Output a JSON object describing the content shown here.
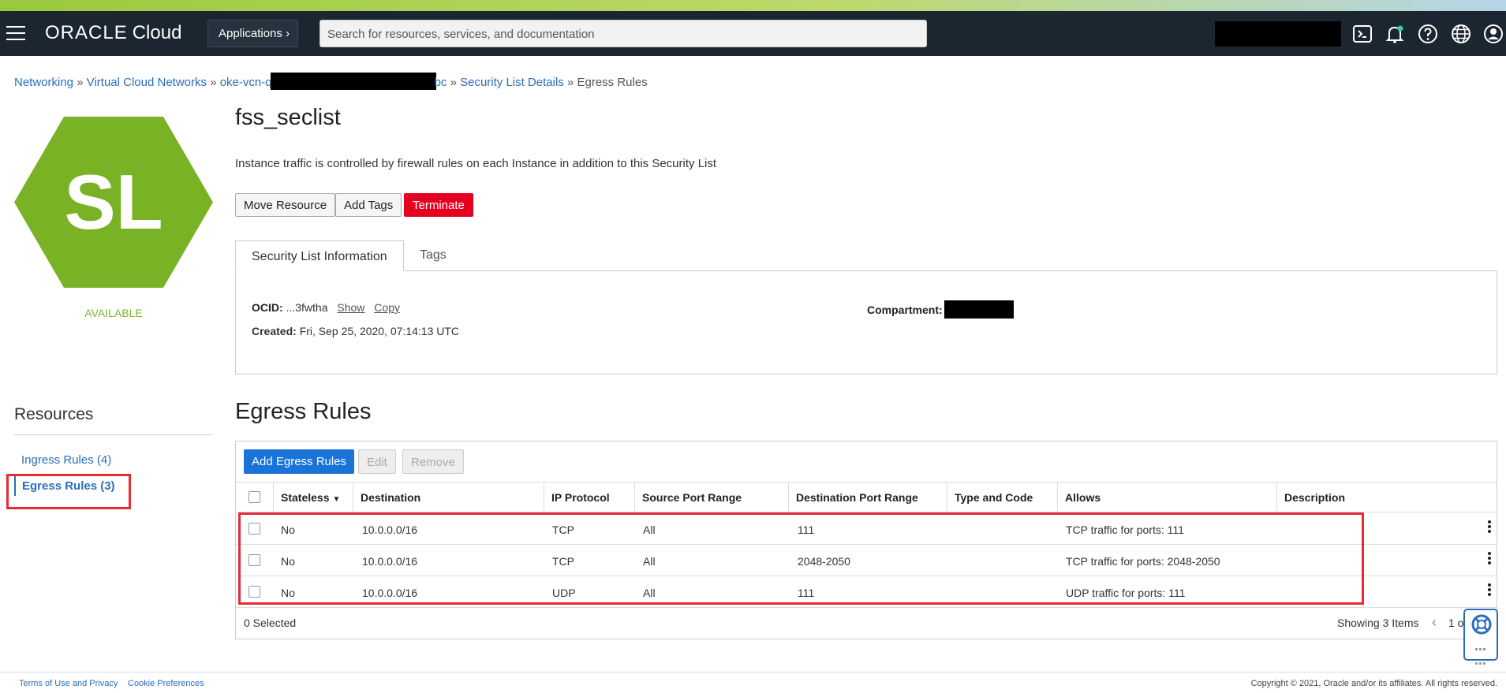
{
  "topbar": {
    "logo_brand": "ORACLE",
    "logo_product": "Cloud",
    "applications_label": "Applications",
    "applications_chevron": "›",
    "search_placeholder": "Search for resources, services, and documentation",
    "icons": [
      "cloud-shell-icon",
      "notifications-icon",
      "help-icon",
      "language-globe-icon",
      "profile-icon"
    ]
  },
  "breadcrumb": {
    "items": [
      "Networking",
      "Virtual Cloud Networks",
      "oke-vcn-q",
      "bc",
      "Security List Details",
      "Egress Rules"
    ],
    "separator": "»"
  },
  "resource": {
    "icon_letters": "SL",
    "status": "AVAILABLE",
    "title": "fss_seclist",
    "description": "Instance traffic is controlled by firewall rules on each Instance in addition to this Security List",
    "colors": {
      "hexagon": "#7ab226",
      "status": "#7db42c",
      "terminate": "#e6001f",
      "primary": "#1a73d9",
      "highlight": "#e52b35"
    }
  },
  "actions": {
    "move_resource": "Move Resource",
    "add_tags": "Add Tags",
    "terminate": "Terminate"
  },
  "tabs": {
    "info": "Security List Information",
    "tags": "Tags"
  },
  "info": {
    "ocid_label": "OCID:",
    "ocid_value": "...3fwtha",
    "show": "Show",
    "copy": "Copy",
    "created_label": "Created:",
    "created_value": "Fri, Sep 25, 2020, 07:14:13 UTC",
    "compartment_label": "Compartment:"
  },
  "resources_nav": {
    "title": "Resources",
    "items": [
      "Ingress Rules (4)",
      "Egress Rules (3)"
    ]
  },
  "egress": {
    "title": "Egress Rules",
    "add_button": "Add Egress Rules",
    "edit_button": "Edit",
    "remove_button": "Remove",
    "headers": [
      "Stateless",
      "Destination",
      "IP Protocol",
      "Source Port Range",
      "Destination Port Range",
      "Type and Code",
      "Allows",
      "Description"
    ],
    "sort_indicator": "▼",
    "rows": [
      {
        "stateless": "No",
        "destination": "10.0.0.0/16",
        "protocol": "TCP",
        "source_port": "All",
        "dest_port": "111",
        "type_code": "",
        "allows": "TCP traffic for ports: 111",
        "description": ""
      },
      {
        "stateless": "No",
        "destination": "10.0.0.0/16",
        "protocol": "TCP",
        "source_port": "All",
        "dest_port": "2048-2050",
        "type_code": "",
        "allows": "TCP traffic for ports: 2048-2050",
        "description": ""
      },
      {
        "stateless": "No",
        "destination": "10.0.0.0/16",
        "protocol": "UDP",
        "source_port": "All",
        "dest_port": "111",
        "type_code": "",
        "allows": "UDP traffic for ports: 111",
        "description": ""
      }
    ],
    "selected_count": "0 Selected",
    "showing": "Showing 3 Items",
    "pager_prev": "‹",
    "page_text": "1 o"
  },
  "footer": {
    "terms": "Terms of Use and Privacy",
    "cookies": "Cookie Preferences",
    "copyright": "Copyright © 2021, Oracle and/or its affiliates. All rights reserved."
  }
}
